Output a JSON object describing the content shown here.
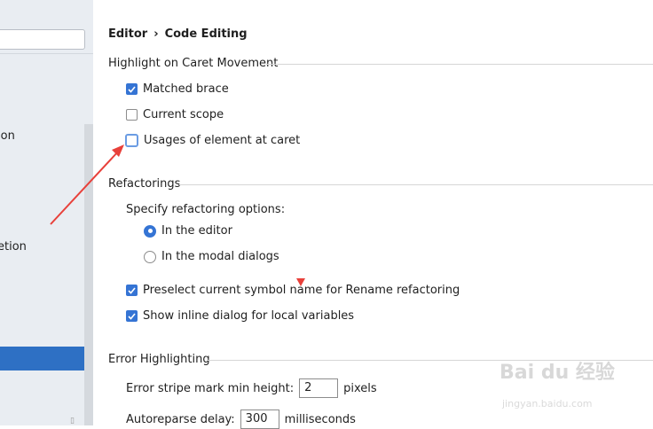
{
  "sidebar": {
    "search_value": "",
    "items": [
      {
        "label": "ion"
      },
      {
        "label": "etion"
      }
    ]
  },
  "breadcrumb": {
    "parent": "Editor",
    "separator": "›",
    "current": "Code Editing"
  },
  "caret_group": {
    "title": "Highlight on Caret Movement",
    "options": [
      {
        "label": "Matched brace",
        "checked": true
      },
      {
        "label": "Current scope",
        "checked": false
      },
      {
        "label": "Usages of element at caret",
        "checked": false
      }
    ]
  },
  "refactor_group": {
    "title": "Refactorings",
    "specify_label": "Specify refactoring options:",
    "radio_editor": "In the editor",
    "radio_modal": "In the modal dialogs",
    "preselect_label": "Preselect current symbol name for Rename refactoring",
    "inline_dialog_label": "Show inline dialog for local variables"
  },
  "error_group": {
    "title": "Error Highlighting",
    "stripe_label": "Error stripe mark min height:",
    "stripe_value": "2",
    "stripe_unit": "pixels",
    "autoreparse_label": "Autoreparse delay:",
    "autoreparse_value": "300",
    "autoreparse_unit": "milliseconds"
  },
  "colors": {
    "accent": "#3574d4",
    "selection": "#2e70c4",
    "annotation_arrow": "#e8403a"
  }
}
